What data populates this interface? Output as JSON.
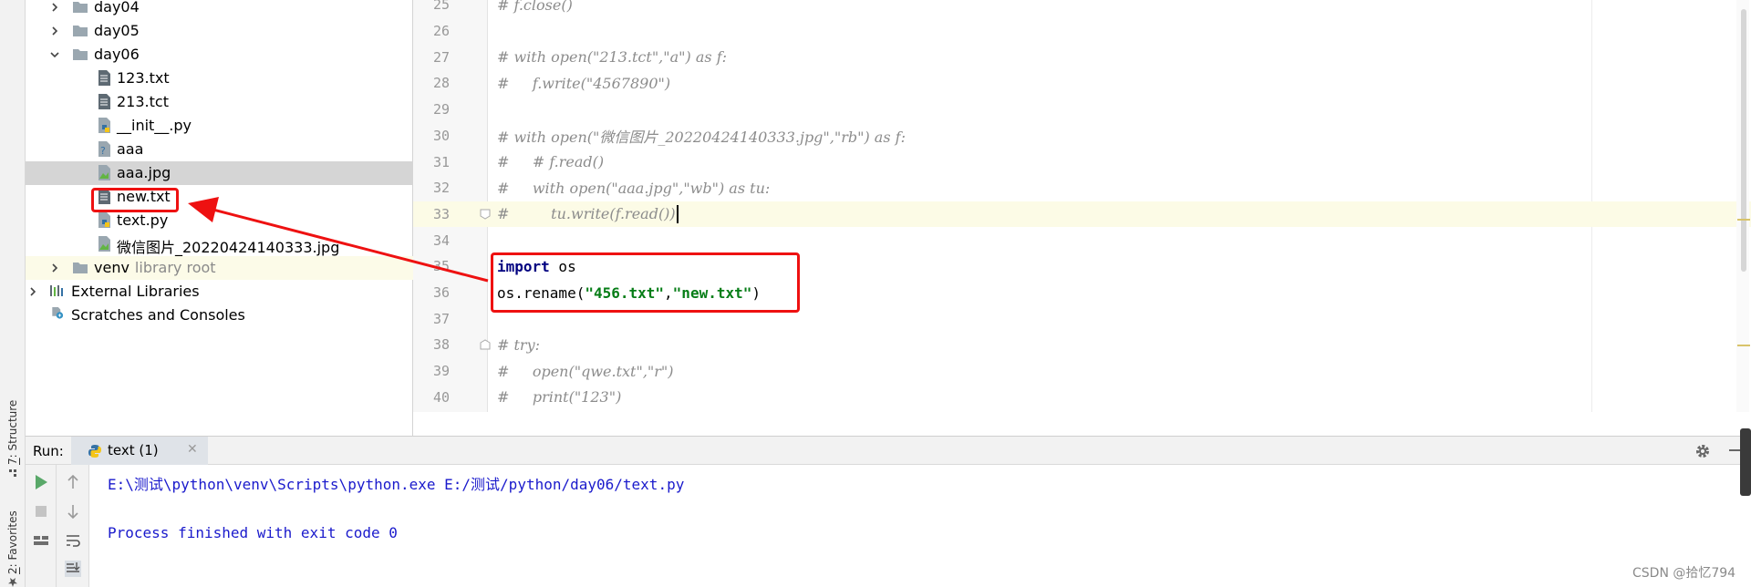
{
  "project_tree": {
    "items": [
      {
        "label": "day04",
        "type": "folder"
      },
      {
        "label": "day05",
        "type": "folder"
      },
      {
        "label": "day06",
        "type": "folder"
      },
      {
        "label": "123.txt",
        "type": "text-file"
      },
      {
        "label": "213.tct",
        "type": "text-file"
      },
      {
        "label": "__init__.py",
        "type": "python-file"
      },
      {
        "label": "aaa",
        "type": "unknown-file"
      },
      {
        "label": "aaa.jpg",
        "type": "image-file"
      },
      {
        "label": "new.txt",
        "type": "text-file"
      },
      {
        "label": "text.py",
        "type": "python-file"
      },
      {
        "label": "微信图片_20220424140333.jpg",
        "type": "image-file"
      },
      {
        "label": "venv",
        "secondary": "library root",
        "type": "folder"
      },
      {
        "label": "External Libraries",
        "type": "libraries"
      },
      {
        "label": "Scratches and Consoles",
        "type": "scratches"
      }
    ]
  },
  "tool_tabs": {
    "structure": {
      "key": "7",
      "label": ": Structure"
    },
    "favorites": {
      "key": "2",
      "label": ": Favorites"
    }
  },
  "editor": {
    "lines": [
      {
        "n": "25",
        "comment": "# f.close()"
      },
      {
        "n": "26",
        "comment": ""
      },
      {
        "n": "27",
        "comment": "# with open(\"213.tct\",\"a\") as f:"
      },
      {
        "n": "28",
        "comment": "#     f.write(\"4567890\")"
      },
      {
        "n": "29",
        "comment": ""
      },
      {
        "n": "30",
        "comment": "# with open(\"微信图片_20220424140333.jpg\",\"rb\") as f:"
      },
      {
        "n": "31",
        "comment": "#     # f.read()"
      },
      {
        "n": "32",
        "comment": "#     with open(\"aaa.jpg\",\"wb\") as tu:"
      },
      {
        "n": "33",
        "comment": "#         tu.write(f.read())"
      },
      {
        "n": "34",
        "comment": ""
      },
      {
        "n": "35",
        "kw": "import",
        "rest": " os"
      },
      {
        "n": "36",
        "pre": "os.rename(",
        "s1": "\"456.txt\"",
        "mid": ",",
        "s2": "\"new.txt\"",
        "post": ")"
      },
      {
        "n": "37",
        "comment": ""
      },
      {
        "n": "38",
        "comment": "# try:"
      },
      {
        "n": "39",
        "comment": "#     open(\"qwe.txt\",\"r\")"
      },
      {
        "n": "40",
        "comment": "#     print(\"123\")"
      }
    ]
  },
  "run_panel": {
    "title": "Run:",
    "tab_label": "text (1)",
    "console_lines": [
      "E:\\测试\\python\\venv\\Scripts\\python.exe E:/测试/python/day06/text.py",
      "Process finished with exit code 0"
    ]
  },
  "watermark": "CSDN @拾忆794",
  "colors": {
    "annotation": "#ee1111",
    "selected_row": "#d5d5d5",
    "current_line": "#fcfbe6",
    "console_text": "#1a1acc",
    "comment": "#8c8c8c"
  }
}
